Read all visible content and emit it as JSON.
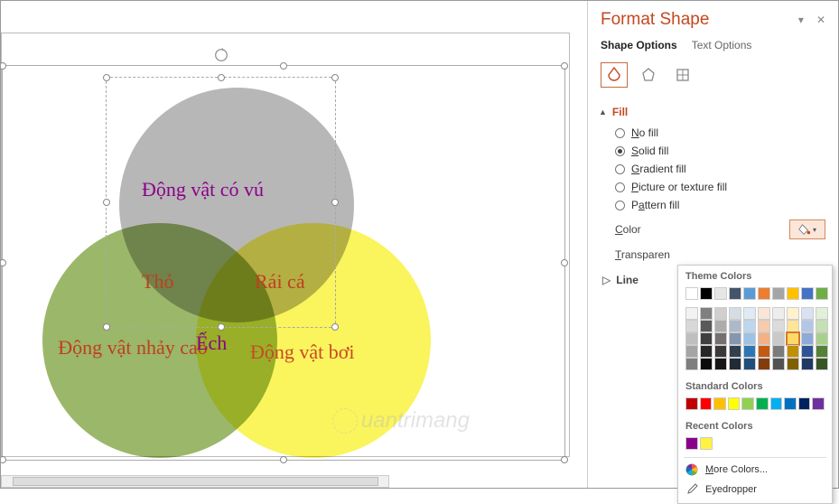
{
  "panel": {
    "title": "Format Shape",
    "tabs": {
      "shape_options": "Shape Options",
      "text_options": "Text Options"
    },
    "fill": {
      "header": "Fill",
      "no_fill": "No fill",
      "solid_fill": "Solid fill",
      "gradient_fill": "Gradient fill",
      "picture_fill": "Picture or texture fill",
      "pattern_fill": "Pattern fill",
      "color_label": "Color",
      "transparency_label": "Transparen"
    },
    "line": {
      "header": "Line"
    }
  },
  "color_picker": {
    "theme_title": "Theme Colors",
    "standard_title": "Standard Colors",
    "recent_title": "Recent Colors",
    "more_colors": "More Colors...",
    "eyedropper": "Eyedropper",
    "theme_row1": [
      "#ffffff",
      "#000000",
      "#e7e6e6",
      "#44546a",
      "#5b9bd5",
      "#ed7d31",
      "#a5a5a5",
      "#ffc000",
      "#4472c4",
      "#70ad47"
    ],
    "theme_shades": [
      [
        "#f2f2f2",
        "#7f7f7f",
        "#d0cece",
        "#d6dce4",
        "#deebf6",
        "#fbe5d5",
        "#ededed",
        "#fff2cc",
        "#d9e2f3",
        "#e2efd9"
      ],
      [
        "#d8d8d8",
        "#595959",
        "#aeabab",
        "#adb9ca",
        "#bdd7ee",
        "#f7cbac",
        "#dbdbdb",
        "#fee599",
        "#b4c6e7",
        "#c5e0b3"
      ],
      [
        "#bfbfbf",
        "#3f3f3f",
        "#757070",
        "#8496b0",
        "#9cc3e5",
        "#f4b183",
        "#c9c9c9",
        "#ffd965",
        "#8eaadb",
        "#a8d08d"
      ],
      [
        "#a5a5a5",
        "#262626",
        "#3a3838",
        "#323f4f",
        "#2e75b5",
        "#c55a11",
        "#7b7b7b",
        "#bf9000",
        "#2f5496",
        "#538135"
      ],
      [
        "#7f7f7f",
        "#0c0c0c",
        "#171616",
        "#222a35",
        "#1e4e79",
        "#833c0b",
        "#525252",
        "#7f6000",
        "#1f3864",
        "#375623"
      ]
    ],
    "standard": [
      "#c00000",
      "#ff0000",
      "#ffc000",
      "#ffff00",
      "#92d050",
      "#00b050",
      "#00b0f0",
      "#0070c0",
      "#002060",
      "#7030a0"
    ],
    "recent": [
      "#8b008b",
      "#fff240"
    ],
    "selected": "#ffd965"
  },
  "venn": {
    "top": "Động vật có vú",
    "left": "Động vật nhảy cao",
    "right": "Động vật bơi",
    "tho": "Thỏ",
    "raica": "Rái cá",
    "ech": "Ếch"
  },
  "watermark": "uantrimang"
}
